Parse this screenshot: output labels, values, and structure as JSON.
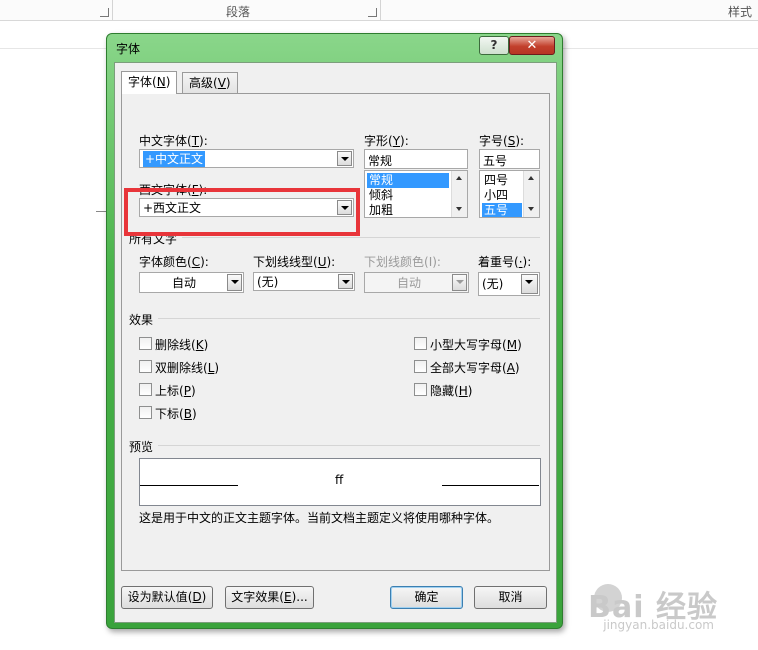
{
  "ribbon": {
    "group_paragraph": "段落",
    "group_style": "样式"
  },
  "dialog": {
    "title": "字体",
    "help_icon": "?",
    "close_icon": "✕",
    "tabs": [
      {
        "label": "字体",
        "hotkey": "N",
        "active": true
      },
      {
        "label": "高级",
        "hotkey": "V",
        "active": false
      }
    ],
    "chinese_font": {
      "label": "中文字体",
      "hotkey": "T",
      "value": "+中文正文"
    },
    "western_font": {
      "label": "西文字体",
      "hotkey": "F",
      "value": "+西文正文"
    },
    "font_style": {
      "label": "字形",
      "hotkey": "Y",
      "value": "常规",
      "options": [
        "常规",
        "倾斜",
        "加粗"
      ],
      "selected": "常规"
    },
    "font_size": {
      "label": "字号",
      "hotkey": "S",
      "value": "五号",
      "options": [
        "四号",
        "小四",
        "五号"
      ],
      "selected": "五号"
    },
    "all_text": {
      "title": "所有文字",
      "font_color": {
        "label": "字体颜色",
        "hotkey": "C",
        "value": "自动"
      },
      "underline_style": {
        "label": "下划线线型",
        "hotkey": "U",
        "value": "(无)"
      },
      "underline_color": {
        "label": "下划线颜色",
        "hotkey": "I",
        "value": "自动",
        "disabled": true
      },
      "emphasis": {
        "label": "着重号",
        "hotkey": "·",
        "value": "(无)"
      }
    },
    "effects": {
      "title": "效果",
      "left": [
        {
          "label": "删除线",
          "hotkey": "K",
          "checked": false
        },
        {
          "label": "双删除线",
          "hotkey": "L",
          "checked": false
        },
        {
          "label": "上标",
          "hotkey": "P",
          "checked": false
        },
        {
          "label": "下标",
          "hotkey": "B",
          "checked": false
        }
      ],
      "right": [
        {
          "label": "小型大写字母",
          "hotkey": "M",
          "checked": false
        },
        {
          "label": "全部大写字母",
          "hotkey": "A",
          "checked": false
        },
        {
          "label": "隐藏",
          "hotkey": "H",
          "checked": false
        }
      ]
    },
    "preview": {
      "title": "预览",
      "sample": "ff",
      "description": "这是用于中文的正文主题字体。当前文档主题定义将使用哪种字体。"
    },
    "buttons": {
      "set_default": {
        "label": "设为默认值",
        "hotkey": "D"
      },
      "text_effects": {
        "label": "文字效果",
        "hotkey": "E",
        "suffix": "..."
      },
      "ok": "确定",
      "cancel": "取消"
    }
  },
  "colors": {
    "highlight_box": "#e8353a",
    "selection": "#3399ff",
    "window_frame": "#49b34a",
    "close_button": "#c2402c"
  },
  "watermark": {
    "main": "Bai 经验",
    "sub": "jingyan.baidu.com"
  }
}
